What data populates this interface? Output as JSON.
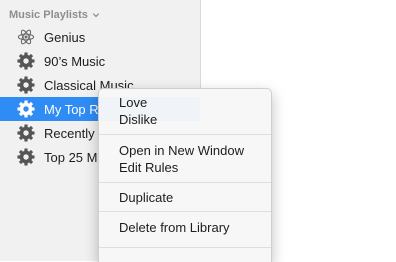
{
  "sidebar": {
    "section_title": "Music Playlists",
    "playlists": [
      {
        "label": "Genius",
        "icon": "genius-atom-icon"
      },
      {
        "label": "90’s Music",
        "icon": "smart-playlist-gear-icon"
      },
      {
        "label": "Classical Music",
        "icon": "smart-playlist-gear-icon"
      },
      {
        "label": "My Top R",
        "icon": "smart-playlist-gear-icon",
        "selected": true
      },
      {
        "label": "Recently",
        "icon": "smart-playlist-gear-icon"
      },
      {
        "label": "Top 25 M",
        "icon": "smart-playlist-gear-icon"
      }
    ]
  },
  "context_menu": {
    "love": "Love",
    "dislike": "Dislike",
    "open_new_window": "Open in New Window",
    "edit_rules": "Edit Rules",
    "duplicate": "Duplicate",
    "delete_from_library": "Delete from Library"
  },
  "colors": {
    "selection": "#2f8cf4",
    "sidebar_bg": "#f1f1f1",
    "header_text": "#8e8e8e"
  }
}
